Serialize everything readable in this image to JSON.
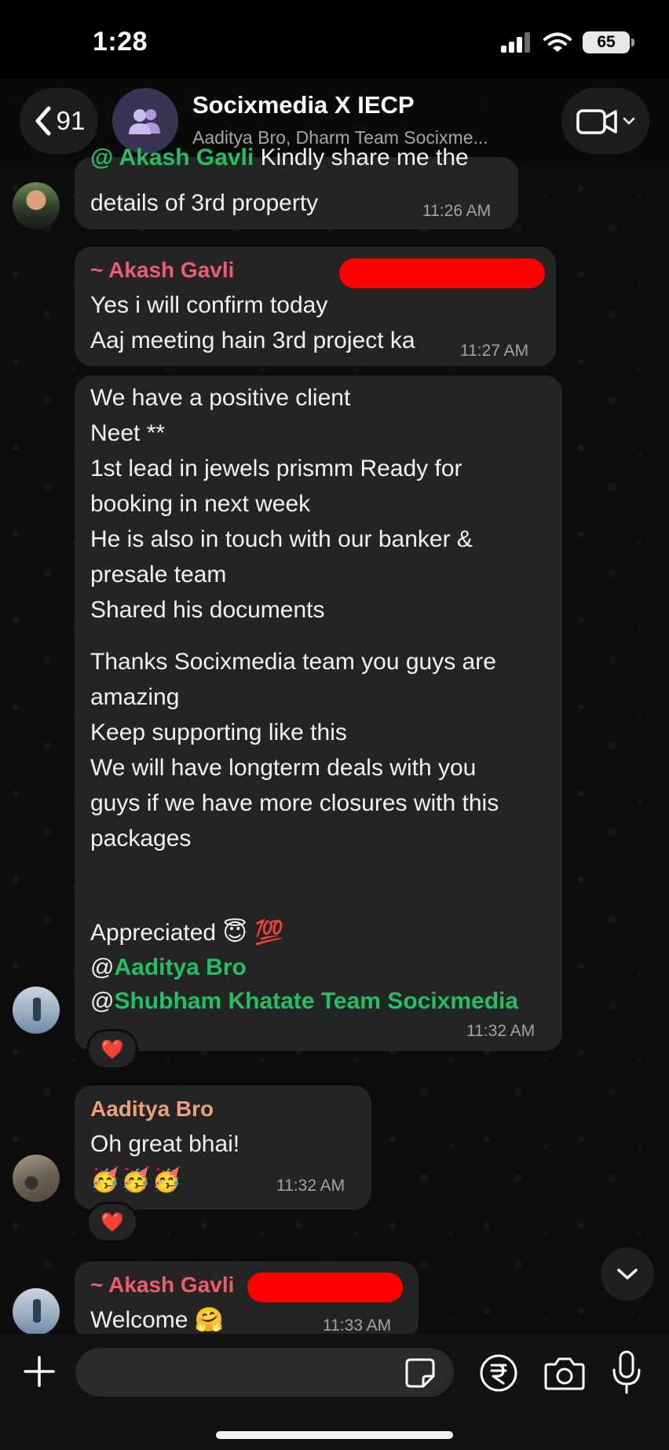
{
  "status_bar": {
    "time": "1:28",
    "battery": "65"
  },
  "header": {
    "back_count": "91",
    "title": "Socixmedia X IECP",
    "subtitle": "Aaditya Bro, Dharm Team Socixme..."
  },
  "messages": [
    {
      "quote_mention": "@ Akash Gavli",
      "quote_text": " Kindly share me the",
      "text": "details of 3rd property",
      "time": "11:26 AM"
    },
    {
      "sender": "~ Akash Gavli",
      "sender_color": "#f15c6d",
      "lines": [
        "Yes i will confirm today",
        "Aaj meeting hain 3rd project ka"
      ],
      "time": "11:27 AM"
    },
    {
      "lines_1": [
        "We have a positive client",
        "Neet **",
        "1st lead in jewels prismm Ready for",
        "booking in next week",
        "He is also in touch with our banker &",
        "presale team",
        "Shared his documents"
      ],
      "lines_2": [
        "Thanks Socixmedia team you guys are",
        "amazing",
        "Keep supporting like this",
        "We will have longterm deals with you",
        "guys if we have more closures with this",
        "packages"
      ],
      "appreciated": "Appreciated",
      "emojis": "😇 💯",
      "at": "@",
      "mention_1": "Aaditya Bro",
      "mention_2": "Shubham Khatate Team Socixmedia",
      "time": "11:32 AM",
      "reaction": "❤️"
    },
    {
      "sender": "Aaditya Bro",
      "sender_color": "#e8a27a",
      "text": "Oh great bhai!",
      "emojis": "🥳🥳🥳",
      "time": "11:32 AM",
      "reaction": "❤️"
    },
    {
      "sender": "~ Akash Gavli",
      "sender_color": "#f15c6d",
      "text": "Welcome",
      "emoji": "🤗",
      "time": "11:33 AM"
    }
  ],
  "input": {
    "placeholder": ""
  },
  "colors": {
    "mention": "#21c063",
    "redaction": "#ff0000",
    "bubble": "#242424"
  }
}
